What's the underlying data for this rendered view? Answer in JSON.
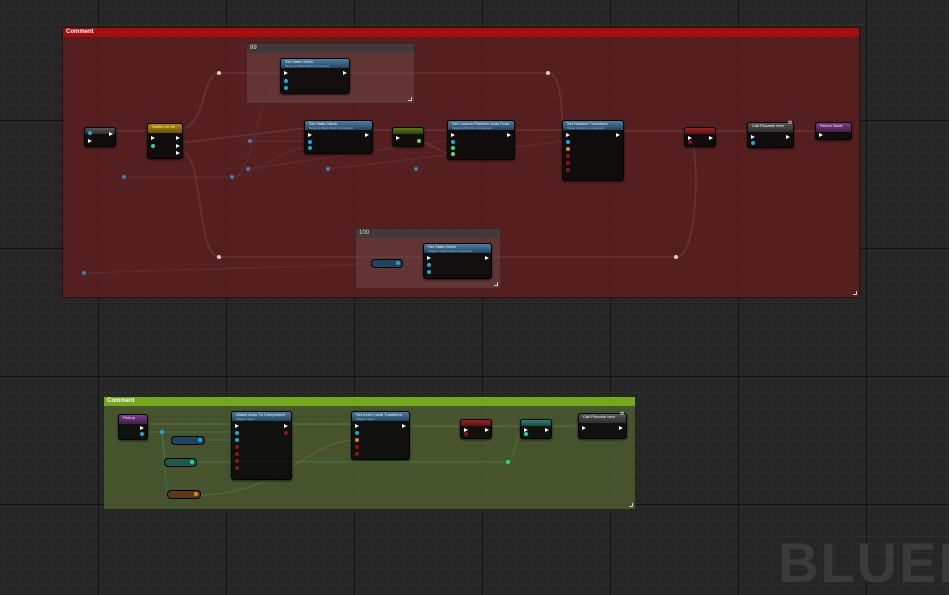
{
  "watermark": "BLUEP",
  "comments": {
    "top": {
      "title": "Comment"
    },
    "bottom": {
      "title": "Comment"
    }
  },
  "subcomments": {
    "a": {
      "title": "99"
    },
    "b": {
      "title": "100"
    }
  },
  "nodes": {
    "n1": {
      "title": "Set Static Mesh",
      "subtitle": "Target is Static Mesh Component"
    },
    "n2": {
      "title": "Set Static Mesh",
      "subtitle": "Target is Static Mesh Component"
    },
    "n3": {
      "title": "Set Custom Primitive Data Float",
      "subtitle": "Target is Primitive Component"
    },
    "n4": {
      "title": "Set Relative Transform",
      "subtitle": "Target is Scene Component"
    },
    "n5": {
      "title": "Set Static Mesh",
      "subtitle": "Target is Static Mesh Component"
    },
    "n6": {
      "title": "Switch on Int"
    },
    "n7": {
      "title": "Call Pickable Item"
    },
    "n8": {
      "title": "Return Node"
    },
    "b1": {
      "title": "Pickup"
    },
    "b2": {
      "title": "Attach Actor To Component",
      "subtitle": "Target is Actor"
    },
    "b3": {
      "title": "Set Actor Local Transform",
      "subtitle": "Target is Actor"
    },
    "b4": {
      "title": "Call Pickable Item"
    }
  },
  "colors": {
    "exec": "#ffffff",
    "object": "#1aa9d8",
    "boolean": "#8c1515",
    "float": "#7fd44b",
    "struct": "#e08a1e",
    "int": "#1ee08a"
  }
}
